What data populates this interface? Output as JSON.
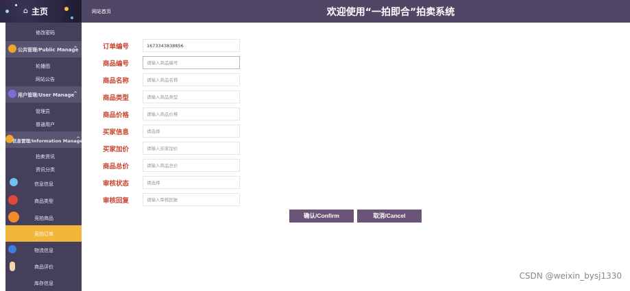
{
  "topbar": {
    "home_label": "主页",
    "home_icon": "home-icon",
    "breadcrumb": "网站首页",
    "system_title": "欢迎使用“一拍即合”拍卖系统"
  },
  "sidebar": {
    "change_password": "修改密码",
    "groups": [
      {
        "label": "公共管理/Public Manage",
        "chevron": "^"
      },
      {
        "label": "用户管理/User Manage",
        "chevron": "^"
      },
      {
        "label": "信息管理/Information Manage",
        "chevron": "^"
      }
    ],
    "public_items": [
      "轮播图",
      "网站公告"
    ],
    "user_items": [
      "管理员",
      "普通用户"
    ],
    "info_items": [
      "拍卖资讯",
      "资讯分类"
    ],
    "menu_items": [
      "信息信息",
      "商品类型",
      "竞拍商品",
      "竞拍订单",
      "物流信息",
      "商品评价",
      "库存信息"
    ],
    "active_item": "竞拍订单"
  },
  "form": {
    "fields": [
      {
        "label": "订单编号",
        "value": "1673343838856",
        "placeholder": ""
      },
      {
        "label": "商品编号",
        "value": "",
        "placeholder": "请输入商品编号"
      },
      {
        "label": "商品名称",
        "value": "",
        "placeholder": "请输入商品名称"
      },
      {
        "label": "商品类型",
        "value": "",
        "placeholder": "请输入商品类型"
      },
      {
        "label": "商品价格",
        "value": "",
        "placeholder": "请输入商品价格"
      },
      {
        "label": "买家信息",
        "value": "",
        "placeholder": "请选择"
      },
      {
        "label": "买家加价",
        "value": "",
        "placeholder": "请输入买家加价"
      },
      {
        "label": "商品总价",
        "value": "",
        "placeholder": "请输入商品总价"
      },
      {
        "label": "审核状态",
        "value": "",
        "placeholder": "请选择"
      },
      {
        "label": "审核回复",
        "value": "",
        "placeholder": "请输入审核回复"
      }
    ],
    "confirm_label": "确认/Confirm",
    "cancel_label": "取消/Cancel"
  },
  "watermark": "CSDN @weixin_bysj1330",
  "colors": {
    "topbar": "#4f4765",
    "sidebar": "#463f5c",
    "active": "#f3b53a",
    "label": "#c8442f",
    "button": "#6b5478"
  }
}
